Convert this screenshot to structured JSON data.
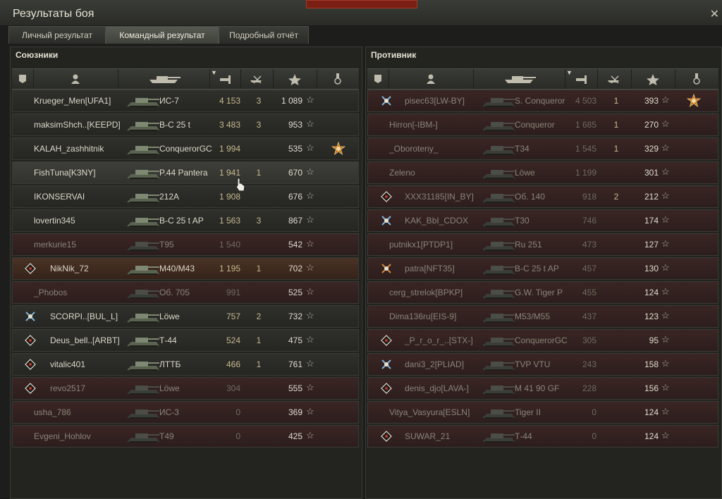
{
  "window": {
    "title": "Результаты боя",
    "close_label": "✕"
  },
  "tabs": [
    {
      "label": "Личный результат",
      "active": false
    },
    {
      "label": "Командный результат",
      "active": true
    },
    {
      "label": "Подробный отчёт",
      "active": false
    }
  ],
  "allies": {
    "title": "Союзники",
    "rows": [
      {
        "name": "Krueger_Men[UFA1]",
        "tank": "ИС-7",
        "damage": "4 153",
        "kills": "3",
        "xp": "1 089",
        "dead": false,
        "badge": "",
        "medal": false
      },
      {
        "name": "maksimShch..[KEEPD]",
        "tank": "В-С 25 t",
        "damage": "3 483",
        "kills": "3",
        "xp": "953",
        "dead": false,
        "badge": "",
        "medal": false
      },
      {
        "name": "KALAH_zashhitnik",
        "tank": "ConquerorGC",
        "damage": "1 994",
        "kills": "",
        "xp": "535",
        "dead": false,
        "badge": "",
        "medal": true
      },
      {
        "name": "FishTuna[K3NY]",
        "tank": "P.44 Pantera",
        "damage": "1 941",
        "kills": "1",
        "xp": "670",
        "dead": false,
        "badge": "",
        "medal": false,
        "highlight": true
      },
      {
        "name": "IKONSERVAI",
        "tank": "212A",
        "damage": "1 908",
        "kills": "",
        "xp": "676",
        "dead": false,
        "badge": "",
        "medal": false
      },
      {
        "name": "lovertin345",
        "tank": "В-С 25 t AP",
        "damage": "1 563",
        "kills": "3",
        "xp": "867",
        "dead": false,
        "badge": "",
        "medal": false
      },
      {
        "name": "merkurie15",
        "tank": "T95",
        "damage": "1 540",
        "kills": "",
        "xp": "542",
        "dead": true,
        "badge": "",
        "medal": false
      },
      {
        "name": "NikNik_72",
        "tank": "M40/M43",
        "damage": "1 195",
        "kills": "1",
        "xp": "702",
        "dead": false,
        "badge": "diamond",
        "medal": false,
        "orange": true
      },
      {
        "name": "_Phobos",
        "tank": "Об. 705",
        "damage": "991",
        "kills": "",
        "xp": "525",
        "dead": true,
        "badge": "",
        "medal": false
      },
      {
        "name": "SCORPI..[BUL_L]",
        "tank": "Löwe",
        "damage": "757",
        "kills": "2",
        "xp": "732",
        "dead": false,
        "badge": "crossed",
        "medal": false
      },
      {
        "name": "Deus_bell..[ARBT]",
        "tank": "Т-44",
        "damage": "524",
        "kills": "1",
        "xp": "475",
        "dead": false,
        "badge": "diamond",
        "medal": false
      },
      {
        "name": "vitalic401",
        "tank": "ЛТТБ",
        "damage": "466",
        "kills": "1",
        "xp": "761",
        "dead": false,
        "badge": "diamond",
        "medal": false
      },
      {
        "name": "revo2517",
        "tank": "Löwe",
        "damage": "304",
        "kills": "",
        "xp": "555",
        "dead": true,
        "badge": "diamond",
        "medal": false
      },
      {
        "name": "usha_786",
        "tank": "ИС-3",
        "damage": "0",
        "kills": "",
        "xp": "369",
        "dead": true,
        "badge": "",
        "medal": false
      },
      {
        "name": "Evgeni_Hohlov",
        "tank": "T49",
        "damage": "0",
        "kills": "",
        "xp": "425",
        "dead": true,
        "badge": "",
        "medal": false
      }
    ]
  },
  "enemies": {
    "title": "Противник",
    "rows": [
      {
        "name": "pisec63[LW-BY]",
        "tank": "S. Conqueror",
        "damage": "4 503",
        "kills": "1",
        "xp": "393",
        "dead": true,
        "badge": "crossed",
        "medal": true
      },
      {
        "name": "Hirron[-IBM-]",
        "tank": "Conqueror",
        "damage": "1 685",
        "kills": "1",
        "xp": "270",
        "dead": true,
        "badge": "",
        "medal": false
      },
      {
        "name": "_Oboroteny_",
        "tank": "T34",
        "damage": "1 545",
        "kills": "1",
        "xp": "329",
        "dead": true,
        "badge": "",
        "medal": false
      },
      {
        "name": "Zeleno",
        "tank": "Löwe",
        "damage": "1 199",
        "kills": "",
        "xp": "301",
        "dead": true,
        "badge": "",
        "medal": false
      },
      {
        "name": "XXX31185[IN_BY]",
        "tank": "Об. 140",
        "damage": "918",
        "kills": "2",
        "xp": "212",
        "dead": true,
        "badge": "diamond",
        "medal": false
      },
      {
        "name": "KAK_BbI_CDOX",
        "tank": "T30",
        "damage": "746",
        "kills": "",
        "xp": "174",
        "dead": true,
        "badge": "crossed",
        "medal": false
      },
      {
        "name": "putnikx1[PTDP1]",
        "tank": "Ru 251",
        "damage": "473",
        "kills": "",
        "xp": "127",
        "dead": true,
        "badge": "",
        "medal": false
      },
      {
        "name": "patra[NFT35]",
        "tank": "В-С 25 t AP",
        "damage": "457",
        "kills": "",
        "xp": "130",
        "dead": true,
        "badge": "crossed-orange",
        "medal": false
      },
      {
        "name": "cerg_strelok[BPKP]",
        "tank": "G.W. Tiger P",
        "damage": "455",
        "kills": "",
        "xp": "124",
        "dead": true,
        "badge": "",
        "medal": false
      },
      {
        "name": "Dima136ru[EIS-9]",
        "tank": "M53/M55",
        "damage": "437",
        "kills": "",
        "xp": "123",
        "dead": true,
        "badge": "",
        "medal": false
      },
      {
        "name": "_P_r_o_r_..[STX-]",
        "tank": "ConquerorGC",
        "damage": "305",
        "kills": "",
        "xp": "95",
        "dead": true,
        "badge": "diamond",
        "medal": false
      },
      {
        "name": "dani3_2[PLIAD]",
        "tank": "TVP VTU",
        "damage": "243",
        "kills": "",
        "xp": "158",
        "dead": true,
        "badge": "crossed",
        "medal": false
      },
      {
        "name": "denis_djo[LAVA-]",
        "tank": "M 41 90 GF",
        "damage": "228",
        "kills": "",
        "xp": "156",
        "dead": true,
        "badge": "diamond",
        "medal": false
      },
      {
        "name": "Vitya_Vasyura[ESLN]",
        "tank": "Tiger II",
        "damage": "0",
        "kills": "",
        "xp": "124",
        "dead": true,
        "badge": "",
        "medal": false
      },
      {
        "name": "SUWAR_21",
        "tank": "Т-44",
        "damage": "0",
        "kills": "",
        "xp": "124",
        "dead": true,
        "badge": "diamond",
        "medal": false
      }
    ]
  },
  "icons": {
    "header": [
      "squad-icon",
      "player-icon",
      "tank-icon",
      "damage-icon",
      "kills-icon",
      "xp-star-icon",
      "medal-icon"
    ],
    "row_star": "☆"
  },
  "colors": {
    "accent": "#c7b98d",
    "dead_row": "#3a2524",
    "highlight_row": "#3e3f3a"
  }
}
